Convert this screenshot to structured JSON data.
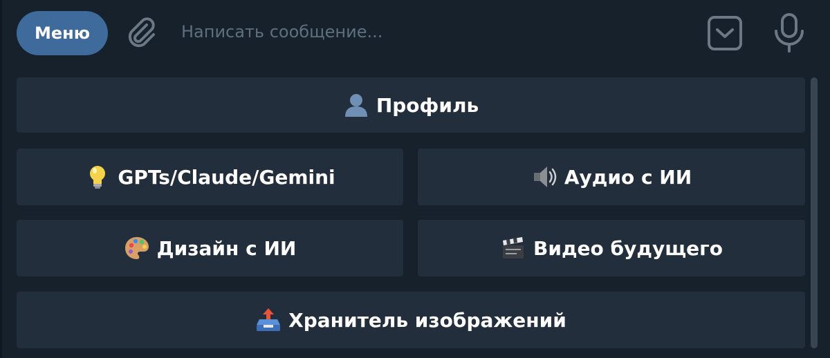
{
  "composer": {
    "menu_label": "Меню",
    "message_placeholder": "Написать сообщение..."
  },
  "keyboard": {
    "buttons": [
      {
        "label": "Профиль",
        "icon": "bust-silhouette-icon"
      },
      {
        "label": "GPTs/Claude/Gemini",
        "icon": "light-bulb-icon"
      },
      {
        "label": "Аудио с ИИ",
        "icon": "speaker-icon"
      },
      {
        "label": "Дизайн с ИИ",
        "icon": "artist-palette-icon"
      },
      {
        "label": "Видео будущего",
        "icon": "clapper-board-icon"
      },
      {
        "label": "Хранитель изображений",
        "icon": "outbox-tray-icon"
      }
    ]
  },
  "colors": {
    "background": "#17212b",
    "button_bg": "#232e3c",
    "menu_button": "#3e6a9c",
    "icon_gray": "#6c7884",
    "placeholder": "#5f6f80"
  }
}
